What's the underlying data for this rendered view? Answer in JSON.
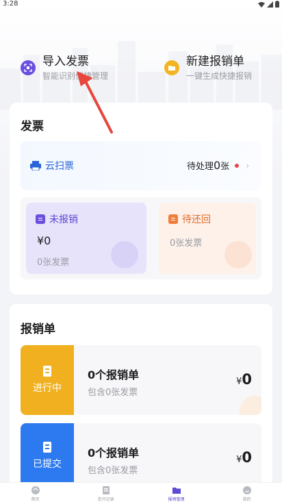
{
  "status": {
    "time": "3:28"
  },
  "quick_actions": [
    {
      "title": "导入发票",
      "subtitle": "智能识别便捷管理",
      "icon": "import-icon",
      "color": "#6a4ee0"
    },
    {
      "title": "新建报销单",
      "subtitle": "一键生成快捷报销",
      "icon": "folder-icon",
      "color": "#f2b521"
    }
  ],
  "invoice": {
    "title": "发票",
    "scan": {
      "label": "云扫票",
      "pending_prefix": "待处理",
      "pending_count": "0",
      "pending_suffix": "张"
    },
    "unreimbursed": {
      "label": "未报销",
      "amount": "¥0",
      "count": "0张发票",
      "color": "#6a4ee0"
    },
    "to_return": {
      "label": "待还回",
      "count": "0张发票",
      "color": "#ef7d3c"
    }
  },
  "reimbursement": {
    "title": "报销单",
    "rows": [
      {
        "tag": "进行中",
        "count": "0个报销单",
        "sub": "包含0张发票",
        "currency": "¥",
        "amount": "0",
        "color": "#f0b020"
      },
      {
        "tag": "已提交",
        "count": "0个报销单",
        "sub": "包含0张发票",
        "currency": "¥",
        "amount": "0",
        "color": "#2d7af0"
      }
    ]
  },
  "tabs": [
    {
      "label": "首页",
      "icon": "home-icon"
    },
    {
      "label": "支付记录",
      "icon": "receipt-icon"
    },
    {
      "label": "报销管理",
      "icon": "folder-icon",
      "active": true
    },
    {
      "label": "我的",
      "icon": "smile-icon"
    }
  ]
}
